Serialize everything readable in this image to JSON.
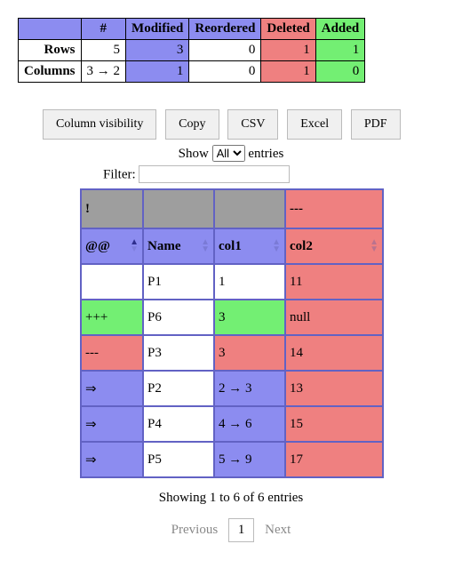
{
  "summary": {
    "headers": {
      "corner": "",
      "count": "#",
      "modified": "Modified",
      "reordered": "Reordered",
      "deleted": "Deleted",
      "added": "Added"
    },
    "rows_label": "Rows",
    "cols_label": "Columns",
    "rows": {
      "count": "5",
      "modified": "3",
      "reordered": "0",
      "deleted": "1",
      "added": "1"
    },
    "columns": {
      "count": "3 → 2",
      "modified": "1",
      "reordered": "0",
      "deleted": "1",
      "added": "0"
    }
  },
  "buttons": {
    "colvis": "Column visibility",
    "copy": "Copy",
    "csv": "CSV",
    "excel": "Excel",
    "pdf": "PDF"
  },
  "length_menu": {
    "prefix": "Show",
    "selected": "All",
    "suffix": "entries"
  },
  "filter": {
    "label": "Filter:",
    "value": ""
  },
  "diff": {
    "header1": {
      "c0": "!",
      "c1": "",
      "c2": "",
      "c3": "---"
    },
    "header2": {
      "c0": "@@",
      "c1": "Name",
      "c2": "col1",
      "c3": "col2"
    },
    "rows": [
      {
        "type": "unch",
        "c0": "",
        "c1": "P1",
        "c2": "1",
        "c3": "11"
      },
      {
        "type": "add",
        "c0": "+++",
        "c1": "P6",
        "c2": "3",
        "c3": "null"
      },
      {
        "type": "del",
        "c0": "---",
        "c1": "P3",
        "c2": "3",
        "c3": "14"
      },
      {
        "type": "mod",
        "c0": "⇒",
        "c1": "P2",
        "c2": "2 → 3",
        "c3": "13"
      },
      {
        "type": "mod",
        "c0": "⇒",
        "c1": "P4",
        "c2": "4 → 6",
        "c3": "15"
      },
      {
        "type": "mod",
        "c0": "⇒",
        "c1": "P5",
        "c2": "5 → 9",
        "c3": "17"
      }
    ]
  },
  "info": "Showing 1 to 6 of 6 entries",
  "paginate": {
    "prev": "Previous",
    "page": "1",
    "next": "Next"
  }
}
